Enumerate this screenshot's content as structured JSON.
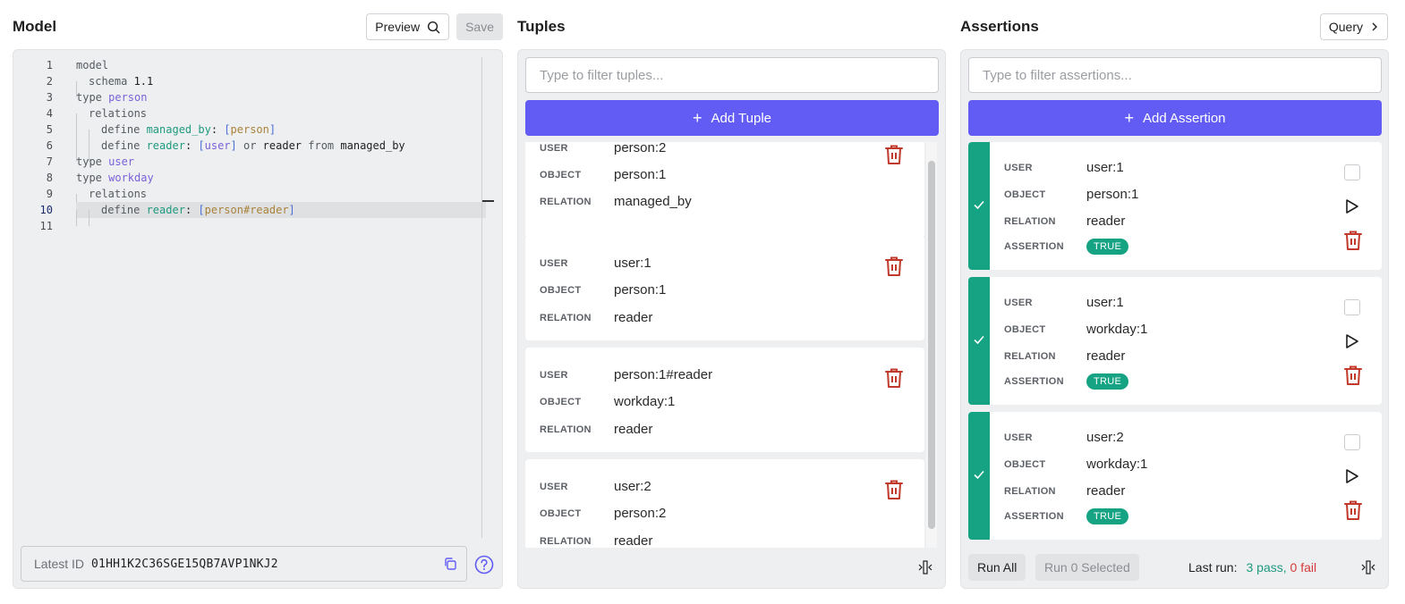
{
  "model": {
    "title": "Model",
    "preview_label": "Preview",
    "save_label": "Save",
    "code_lines": [
      {
        "n": "1",
        "tokens": [
          {
            "t": "model",
            "c": "kw"
          }
        ]
      },
      {
        "n": "2",
        "guides": 1,
        "tokens": [
          {
            "t": "schema ",
            "c": "kw"
          },
          {
            "t": "1.1",
            "c": "num"
          }
        ]
      },
      {
        "n": "3",
        "tokens": [
          {
            "t": "type ",
            "c": "kw"
          },
          {
            "t": "person",
            "c": "tname"
          }
        ]
      },
      {
        "n": "4",
        "guides": 1,
        "tokens": [
          {
            "t": "relations",
            "c": "kw"
          }
        ]
      },
      {
        "n": "5",
        "guides": 2,
        "tokens": [
          {
            "t": "define ",
            "c": "kw"
          },
          {
            "t": "managed_by",
            "c": "rel"
          },
          {
            "t": ": ",
            "c": "plain"
          },
          {
            "t": "[",
            "c": "brk"
          },
          {
            "t": "person",
            "c": "tref"
          },
          {
            "t": "]",
            "c": "brk"
          }
        ]
      },
      {
        "n": "6",
        "guides": 2,
        "tokens": [
          {
            "t": "define ",
            "c": "kw"
          },
          {
            "t": "reader",
            "c": "rel"
          },
          {
            "t": ": ",
            "c": "plain"
          },
          {
            "t": "[",
            "c": "brk"
          },
          {
            "t": "user",
            "c": "tname"
          },
          {
            "t": "]",
            "c": "brk"
          },
          {
            "t": " or ",
            "c": "kw"
          },
          {
            "t": "reader",
            "c": "plain"
          },
          {
            "t": " from ",
            "c": "kw"
          },
          {
            "t": "managed_by",
            "c": "plain"
          }
        ]
      },
      {
        "n": "7",
        "tokens": [
          {
            "t": "type ",
            "c": "kw"
          },
          {
            "t": "user",
            "c": "tname"
          }
        ]
      },
      {
        "n": "8",
        "tokens": [
          {
            "t": "type ",
            "c": "kw"
          },
          {
            "t": "workday",
            "c": "tname"
          }
        ]
      },
      {
        "n": "9",
        "guides": 1,
        "tokens": [
          {
            "t": "relations",
            "c": "kw"
          }
        ]
      },
      {
        "n": "10",
        "guides": 2,
        "active": true,
        "tokens": [
          {
            "t": "define ",
            "c": "kw"
          },
          {
            "t": "reader",
            "c": "rel"
          },
          {
            "t": ": ",
            "c": "plain"
          },
          {
            "t": "[",
            "c": "brk"
          },
          {
            "t": "person#reader",
            "c": "tref"
          },
          {
            "t": "]",
            "c": "brk"
          }
        ]
      },
      {
        "n": "11",
        "tokens": []
      }
    ],
    "latest_id_label": "Latest ID",
    "latest_id_value": "01HH1K2C36SGE15QB7AVP1NKJ2"
  },
  "tuples": {
    "title": "Tuples",
    "filter_placeholder": "Type to filter tuples...",
    "add_label": "Add Tuple",
    "labels": {
      "user": "USER",
      "object": "OBJECT",
      "relation": "RELATION"
    },
    "items": [
      {
        "user": "person:2",
        "object": "person:1",
        "relation": "managed_by"
      },
      {
        "user": "user:1",
        "object": "person:1",
        "relation": "reader"
      },
      {
        "user": "person:1#reader",
        "object": "workday:1",
        "relation": "reader"
      },
      {
        "user": "user:2",
        "object": "person:2",
        "relation": "reader"
      }
    ]
  },
  "assertions": {
    "title": "Assertions",
    "query_label": "Query",
    "filter_placeholder": "Type to filter assertions...",
    "add_label": "Add Assertion",
    "labels": {
      "user": "USER",
      "object": "OBJECT",
      "relation": "RELATION",
      "assertion": "ASSERTION"
    },
    "items": [
      {
        "user": "user:1",
        "object": "person:1",
        "relation": "reader",
        "assertion": "TRUE",
        "status": "pass"
      },
      {
        "user": "user:1",
        "object": "workday:1",
        "relation": "reader",
        "assertion": "TRUE",
        "status": "pass"
      },
      {
        "user": "user:2",
        "object": "workday:1",
        "relation": "reader",
        "assertion": "TRUE",
        "status": "pass"
      }
    ],
    "run_all_label": "Run All",
    "run_selected_label": "Run 0 Selected",
    "last_run_label": "Last run:",
    "pass_text": "3 pass,",
    "fail_text": "0 fail"
  },
  "colors": {
    "accent": "#625cf4",
    "success": "#15a383",
    "danger": "#c0392b"
  }
}
